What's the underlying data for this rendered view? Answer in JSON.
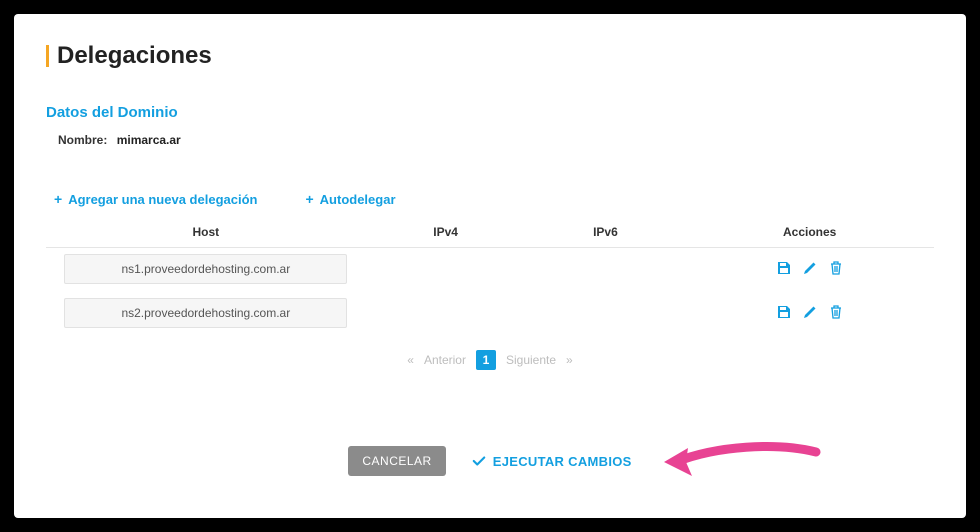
{
  "page": {
    "title": "Delegaciones"
  },
  "domain": {
    "section_title": "Datos del Dominio",
    "name_label": "Nombre:",
    "name_value": "mimarca.ar"
  },
  "toolbar": {
    "add_delegation_label": "Agregar una nueva delegación",
    "autodelegate_label": "Autodelegar"
  },
  "table": {
    "headers": {
      "host": "Host",
      "ipv4": "IPv4",
      "ipv6": "IPv6",
      "actions": "Acciones"
    },
    "rows": [
      {
        "host": "ns1.proveedordehosting.com.ar",
        "ipv4": "",
        "ipv6": ""
      },
      {
        "host": "ns2.proveedordehosting.com.ar",
        "ipv4": "",
        "ipv6": ""
      }
    ]
  },
  "pager": {
    "prev": "Anterior",
    "page": "1",
    "next": "Siguiente"
  },
  "footer": {
    "cancel": "CANCELAR",
    "execute": "EJECUTAR CAMBIOS"
  }
}
